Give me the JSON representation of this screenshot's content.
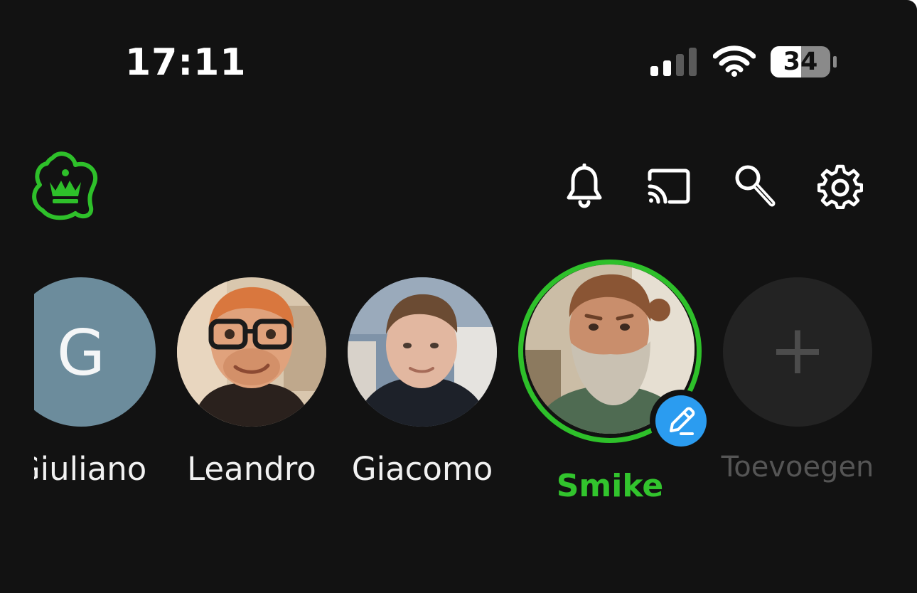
{
  "status_bar": {
    "time": "17:11",
    "battery_level": "34",
    "signal_icon": "cellular-signal-icon",
    "wifi_icon": "wifi-icon",
    "battery_icon": "battery-icon"
  },
  "app_bar": {
    "logo_icon": "kpn-crown-logo-icon",
    "actions": [
      {
        "icon": "bell-icon"
      },
      {
        "icon": "cast-icon"
      },
      {
        "icon": "search-icon"
      },
      {
        "icon": "gear-icon"
      }
    ]
  },
  "profiles": [
    {
      "name": "Giuliano",
      "initial": "G",
      "avatar_color": "#6c8c9c"
    },
    {
      "name": "Leandro",
      "avatar": "cartoon-avatar-glasses"
    },
    {
      "name": "Giacomo",
      "avatar": "photo-avatar"
    },
    {
      "name": "Smike",
      "avatar": "bearded-avatar",
      "selected": true,
      "accent": "#2ec02a"
    },
    {
      "name": "Toevoegen",
      "action": "add-profile",
      "icon": "plus-icon"
    }
  ],
  "edit_badge_icon": "pencil-icon",
  "colors": {
    "background": "#121212",
    "accent_green": "#2ec02a",
    "edit_blue": "#2b9cf0"
  }
}
